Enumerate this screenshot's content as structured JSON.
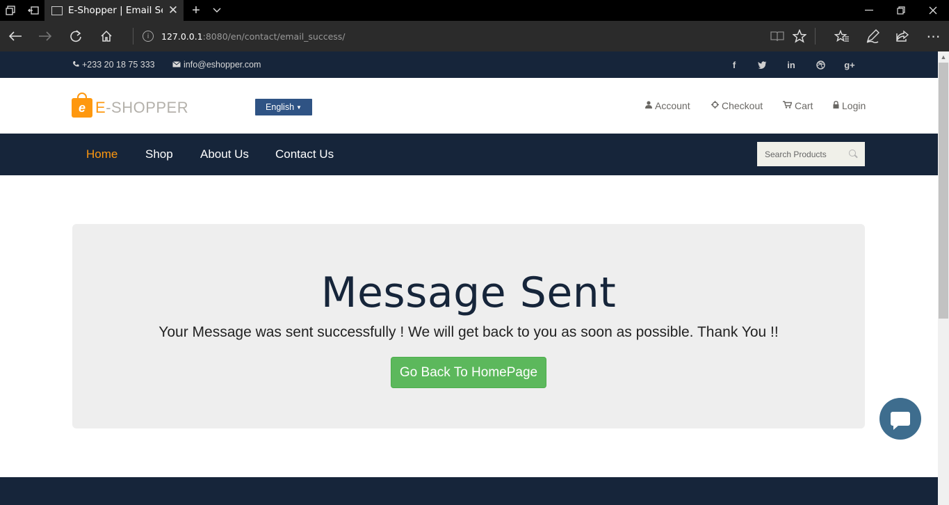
{
  "browser": {
    "tab_title": "E-Shopper | Email Sent",
    "url_host": "127.0.0.1",
    "url_path": ":8080/en/contact/email_success/",
    "icons": {
      "tab_actions": "tabs-icon",
      "set_aside": "set-aside-icon",
      "new_tab": "+",
      "tab_list": "chevron-down-icon",
      "minimize": "minimize-icon",
      "restore": "restore-icon",
      "close": "close-icon",
      "back": "back-arrow-icon",
      "forward": "forward-arrow-icon",
      "refresh": "refresh-icon",
      "home": "home-icon",
      "reading_view": "reading-view-icon",
      "favorite": "star-icon",
      "favorites_hub": "favorites-icon",
      "notes": "pen-icon",
      "share": "share-icon",
      "more": "more-icon"
    }
  },
  "header_top": {
    "phone": "+233 20 18 75 333",
    "email": "info@eshopper.com",
    "social": [
      "f",
      "t",
      "in",
      "drb",
      "g+"
    ]
  },
  "header_middle": {
    "brand_e": "E",
    "brand_rest": "-SHOPPER",
    "logo_letter": "e",
    "language": "English",
    "account": "Account",
    "checkout": "Checkout",
    "cart": "Cart",
    "login": "Login"
  },
  "menu": {
    "home": "Home",
    "shop": "Shop",
    "about": "About Us",
    "contact": "Contact Us",
    "search_placeholder": "Search Products"
  },
  "main": {
    "heading": "Message Sent",
    "message": "Your Message was sent successfully ! We will get back to you as soon as possible. Thank You !!",
    "button": "Go Back To HomePage"
  },
  "colors": {
    "dark_navy": "#16253a",
    "accent_orange": "#fe980f",
    "success_green": "#5cb85c",
    "language_blue": "#2f5384"
  }
}
